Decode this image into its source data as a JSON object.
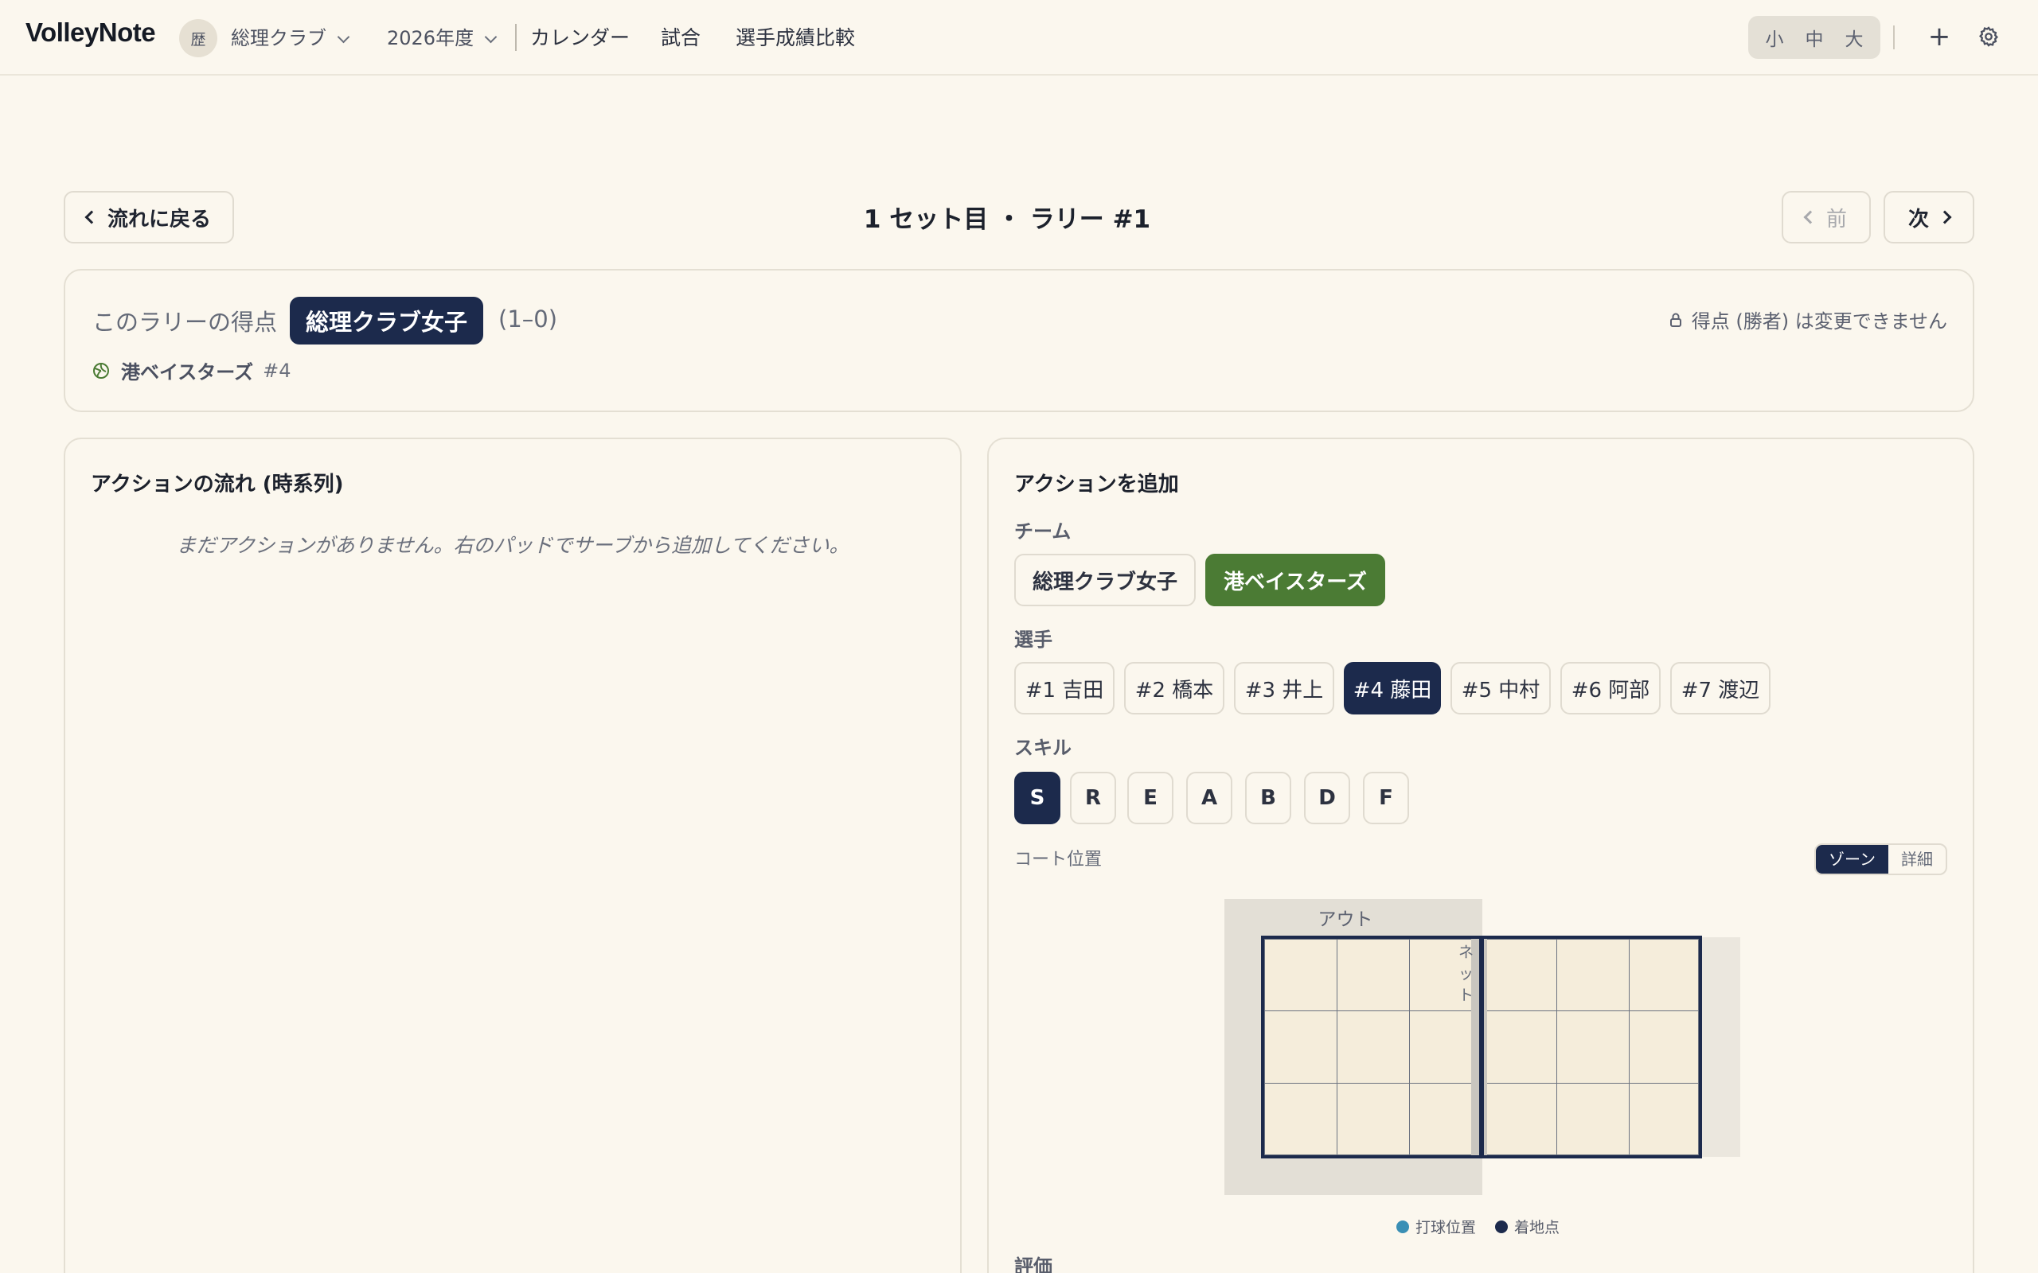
{
  "header": {
    "brand": "VolleyNote",
    "club_avatar": "歴",
    "club_name": "総理クラブ",
    "season": "2026年度",
    "nav": [
      "カレンダー",
      "試合",
      "選手成績比較"
    ],
    "text_sizes": [
      "小",
      "中",
      "大"
    ],
    "add_icon": "plus-icon",
    "settings_icon": "gear-icon"
  },
  "rally": {
    "back_label": "流れに戻る",
    "title": "1 セット目 ・ ラリー #1",
    "prev_label": "前",
    "next_label": "次"
  },
  "score": {
    "label": "このラリーの得点",
    "winner": "総理クラブ女子",
    "value": "(1–0)",
    "lock_note": "得点 (勝者) は変更できません",
    "server_team": "港ベイスターズ",
    "server_number": "#4"
  },
  "flow_panel": {
    "title": "アクションの流れ (時系列)",
    "empty_message": "まだアクションがありません。右のパッドでサーブから追加してください。"
  },
  "add_panel": {
    "title": "アクションを追加",
    "team_label": "チーム",
    "teams": [
      "総理クラブ女子",
      "港ベイスターズ"
    ],
    "selected_team": "港ベイスターズ",
    "player_label": "選手",
    "players": [
      "#1 吉田",
      "#2 橋本",
      "#3 井上",
      "#4 藤田",
      "#5 中村",
      "#6 阿部",
      "#7 渡辺"
    ],
    "selected_player": "#4 藤田",
    "skill_label": "スキル",
    "skills": [
      "S",
      "R",
      "E",
      "A",
      "B",
      "D",
      "F"
    ],
    "selected_skill": "S",
    "court_label": "コート位置",
    "court_modes": [
      "ゾーン",
      "詳細"
    ],
    "selected_mode": "ゾーン",
    "out_label": "アウト",
    "net_label": "ネット",
    "legend": [
      {
        "label": "打球位置",
        "color": "#3a8fb5"
      },
      {
        "label": "着地点",
        "color": "#1c2a4c"
      }
    ],
    "evaluation_label": "評価"
  },
  "colors": {
    "navy": "#1c2a4c",
    "green": "#4b7b34",
    "background": "#fbf7ee"
  }
}
